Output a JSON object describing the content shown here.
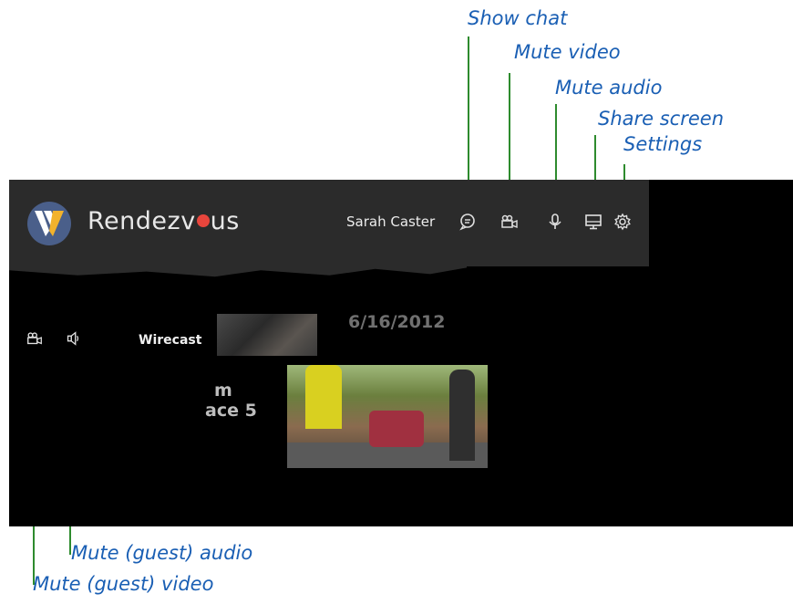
{
  "annotations": {
    "show_chat": "Show chat",
    "mute_video": "Mute video",
    "mute_audio": "Mute audio",
    "share_screen": "Share screen",
    "settings": "Settings",
    "mute_guest_audio": "Mute (guest) audio",
    "mute_guest_video": "Mute (guest) video"
  },
  "app": {
    "brand": {
      "before_dot": "Rendezv",
      "after_dot": "us"
    },
    "user_name": "Sarah Caster",
    "toolbar_icons": [
      "chat-icon",
      "video-camera-icon",
      "microphone-icon",
      "monitor-icon",
      "gear-icon"
    ]
  },
  "guest": {
    "name": "Wirecast",
    "icons": [
      "video-camera-icon",
      "speaker-icon"
    ]
  },
  "video": {
    "date_overlay": "6/16/2012",
    "text_line1": "m",
    "text_line2": "ace 5"
  },
  "colors": {
    "annotation_text": "#1a5fb4",
    "annotation_line": "#2e8b2e",
    "topbar": "#2b2b2b",
    "brand_dot": "#e8453c"
  }
}
